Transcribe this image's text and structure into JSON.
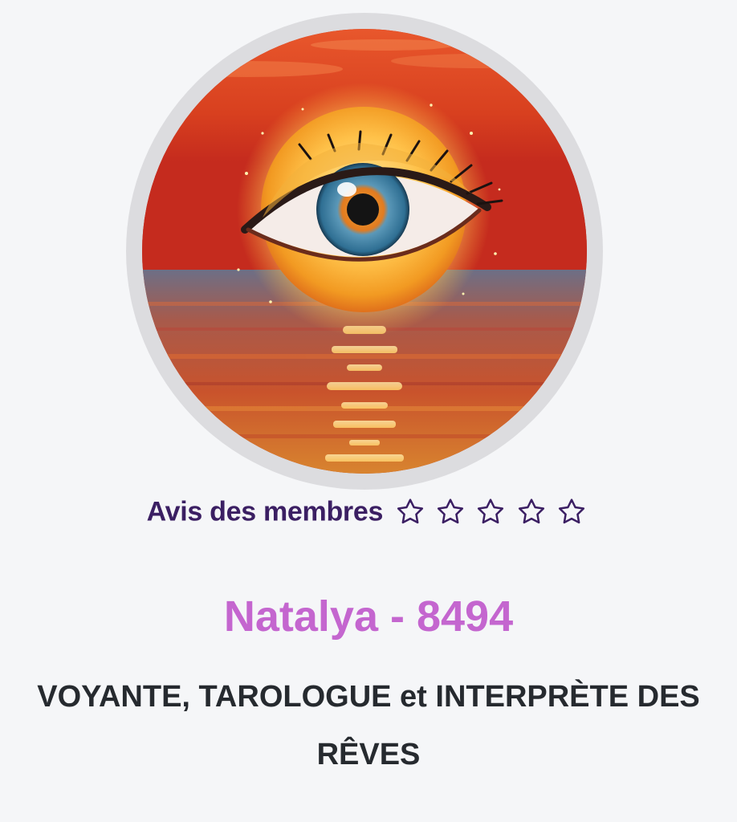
{
  "profile": {
    "avatar_alt": "avatar",
    "rating_label": "Avis des membres",
    "rating_stars": 5,
    "rating_filled": 0,
    "name": "Natalya - 8494",
    "subtitle": "VOYANTE, TAROLOGUE et INTERPRÈTE DES RÊVES"
  },
  "colors": {
    "background": "#f5f6f8",
    "rating_text": "#3b1f63",
    "name_text": "#c466cf",
    "subtitle_text": "#262a2f"
  },
  "icons": [
    "star-outline-icon"
  ]
}
